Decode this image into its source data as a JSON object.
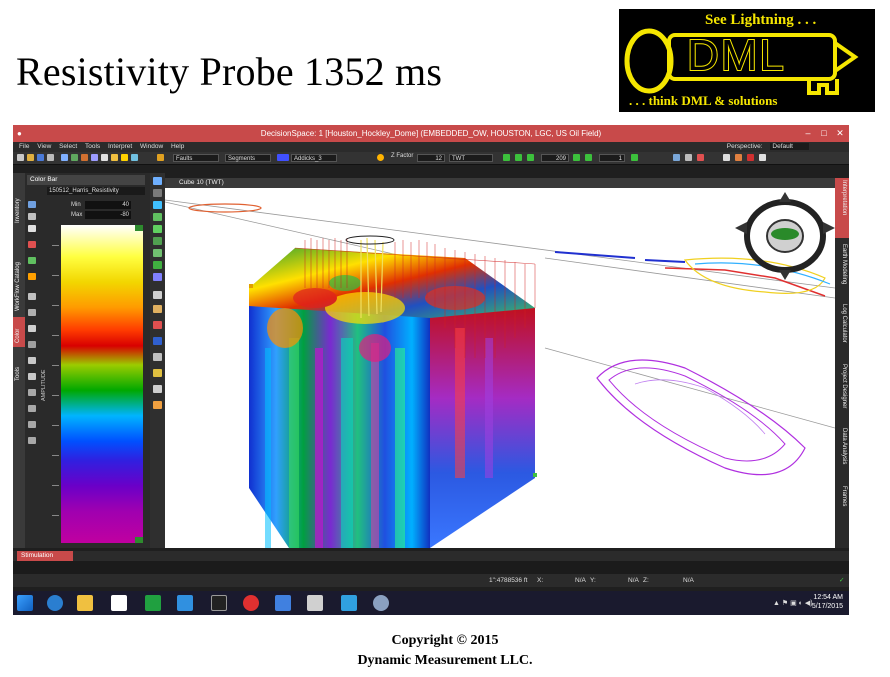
{
  "slide": {
    "title": "Resistivity Probe 1352 ms",
    "copyright_line1": "Copyright  © 2015",
    "copyright_line2": "Dynamic  Measurement LLC."
  },
  "logo": {
    "tagline_top": "See Lightning . . .",
    "brand": "DML",
    "tagline_bottom": ". . . think DML & solutions",
    "colors": {
      "background": "#000000",
      "accent": "#f5e600"
    }
  },
  "app": {
    "window_title": "DecisionSpace: 1 [Houston_Hockley_Dome] (EMBEDDED_OW, HOUSTON, LGC, US Oil Field)",
    "menu": [
      "File",
      "View",
      "Select",
      "Tools",
      "Interpret",
      "Window",
      "Help"
    ],
    "perspective_label": "Perspective:",
    "perspective_value": "Default",
    "toolbar": {
      "faults": "Faults",
      "segments": "Segments",
      "horizon": "Addicks_3",
      "z_factor_label": "Z Factor",
      "z_factor_value": "12",
      "domain": "TWT",
      "frame_value": "209",
      "step_value": "1"
    },
    "left_tabs": [
      "Inventory",
      "WorkFlow Catalog",
      "Color",
      "Tools"
    ],
    "color_bar": {
      "header": "Color Bar",
      "name": "150512_Harris_Resistivity",
      "min_label": "Min",
      "min_value": "40",
      "max_label": "Max",
      "max_value": "-80",
      "property_label": "AMPLITUDE"
    },
    "view_tab": "Cube 10 (TWT)",
    "right_tabs": [
      "Interpretation",
      "Earth Modeling",
      "Log Calculator",
      "Project Designer",
      "Data Analysis",
      "Frames"
    ],
    "bottom_tab": "Stimulation",
    "status": {
      "coord": "1\":4788536 ft",
      "x_label": "X:",
      "x_value": "N/A",
      "y_label": "Y:",
      "y_value": "N/A",
      "z_label": "Z:",
      "z_value": "N/A"
    },
    "accent_color": "#c84a4a"
  },
  "taskbar": {
    "time": "12:54 AM",
    "date": "5/17/2015",
    "pinned_icons": [
      "windows-start-icon",
      "internet-explorer-icon",
      "file-explorer-icon",
      "home-icon",
      "store-icon",
      "mail-icon",
      "pointer-app-icon",
      "cloud-icon",
      "media-icon",
      "paint-icon",
      "settings-icon",
      "globe-icon"
    ]
  }
}
